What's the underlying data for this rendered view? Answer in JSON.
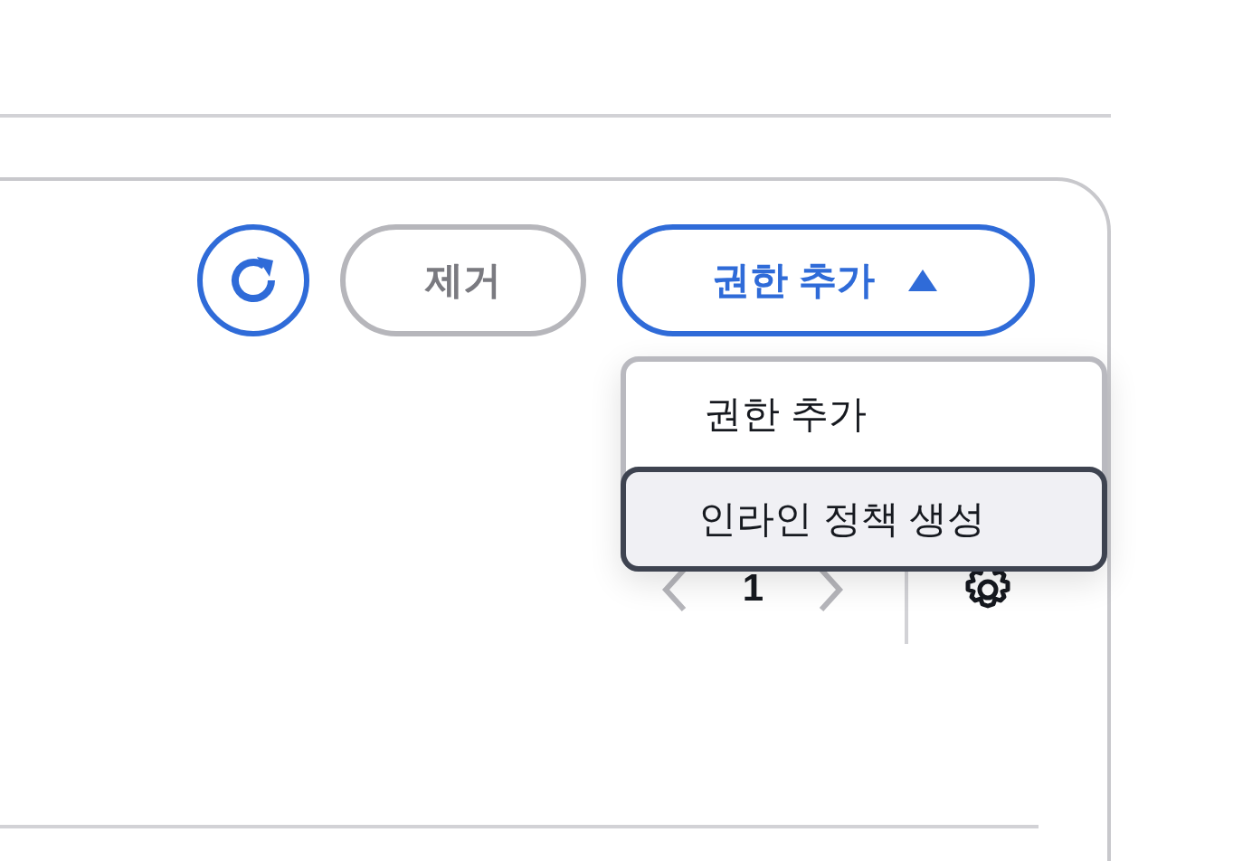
{
  "toolbar": {
    "remove_button": {
      "label": "제거",
      "disabled": true
    },
    "add_button": {
      "label": "권한 추가",
      "expanded": true
    }
  },
  "dropdown_menu": {
    "items": [
      {
        "label": "권한 추가",
        "selected": false
      },
      {
        "label": "인라인 정책 생성",
        "selected": true
      }
    ]
  },
  "pagination": {
    "page": "1"
  }
}
